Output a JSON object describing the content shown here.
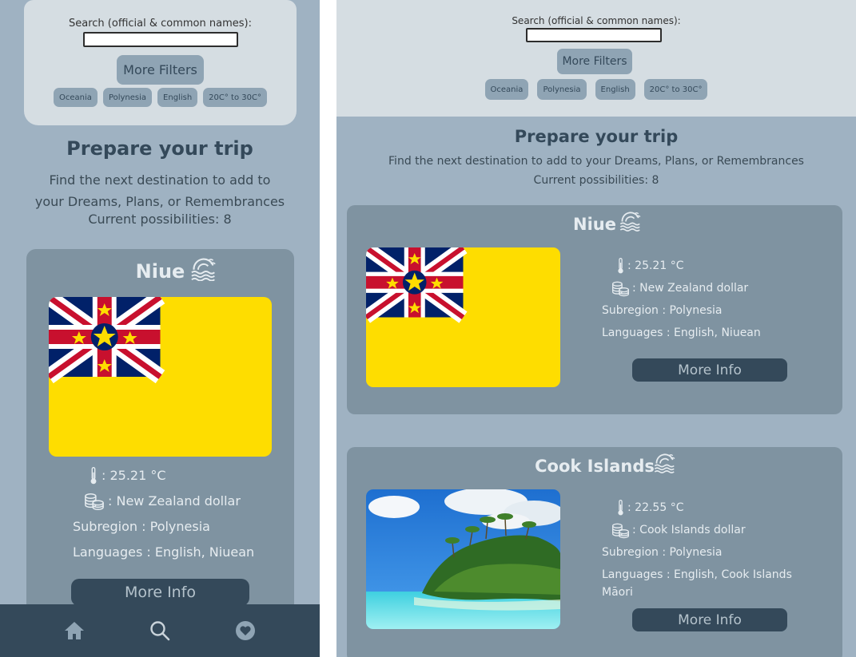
{
  "search": {
    "label": "Search (official & common names):",
    "value": "",
    "more_filters": "More Filters",
    "chips": [
      "Oceania",
      "Polynesia",
      "English",
      "20C° to 30C°"
    ]
  },
  "intro": {
    "title": "Prepare your trip",
    "subtitle": "Find the next destination to add to your Dreams, Plans, or Remembrances",
    "mobile_line1": "Find the next destination to add to",
    "mobile_line2": "your Dreams, Plans, or Remembrances",
    "count": "Current possibilities: 8"
  },
  "cards": [
    {
      "name": "Niue",
      "temperature": ": 25.21 °C",
      "currency": ": New Zealand dollar",
      "subregion": "Subregion : Polynesia",
      "languages": "Languages : English, Niuean",
      "more_info": "More Info",
      "image": "niue-flag"
    },
    {
      "name": "Cook Islands",
      "temperature": ": 22.55 °C",
      "currency": ": Cook Islands dollar",
      "subregion": "Subregion : Polynesia",
      "languages_line1": "Languages : English, Cook Islands",
      "languages_line2": "Māori",
      "more_info": "More Info",
      "image": "tropical-beach-photo"
    }
  ],
  "nav": {
    "items": [
      "home-icon",
      "search-icon",
      "favorites-icon"
    ]
  },
  "colors": {
    "background": "#9fb2c2",
    "search_panel": "#d5dde2",
    "card": "#7f93a1",
    "button_dark": "#34495a",
    "chip": "#8fa4b4"
  }
}
